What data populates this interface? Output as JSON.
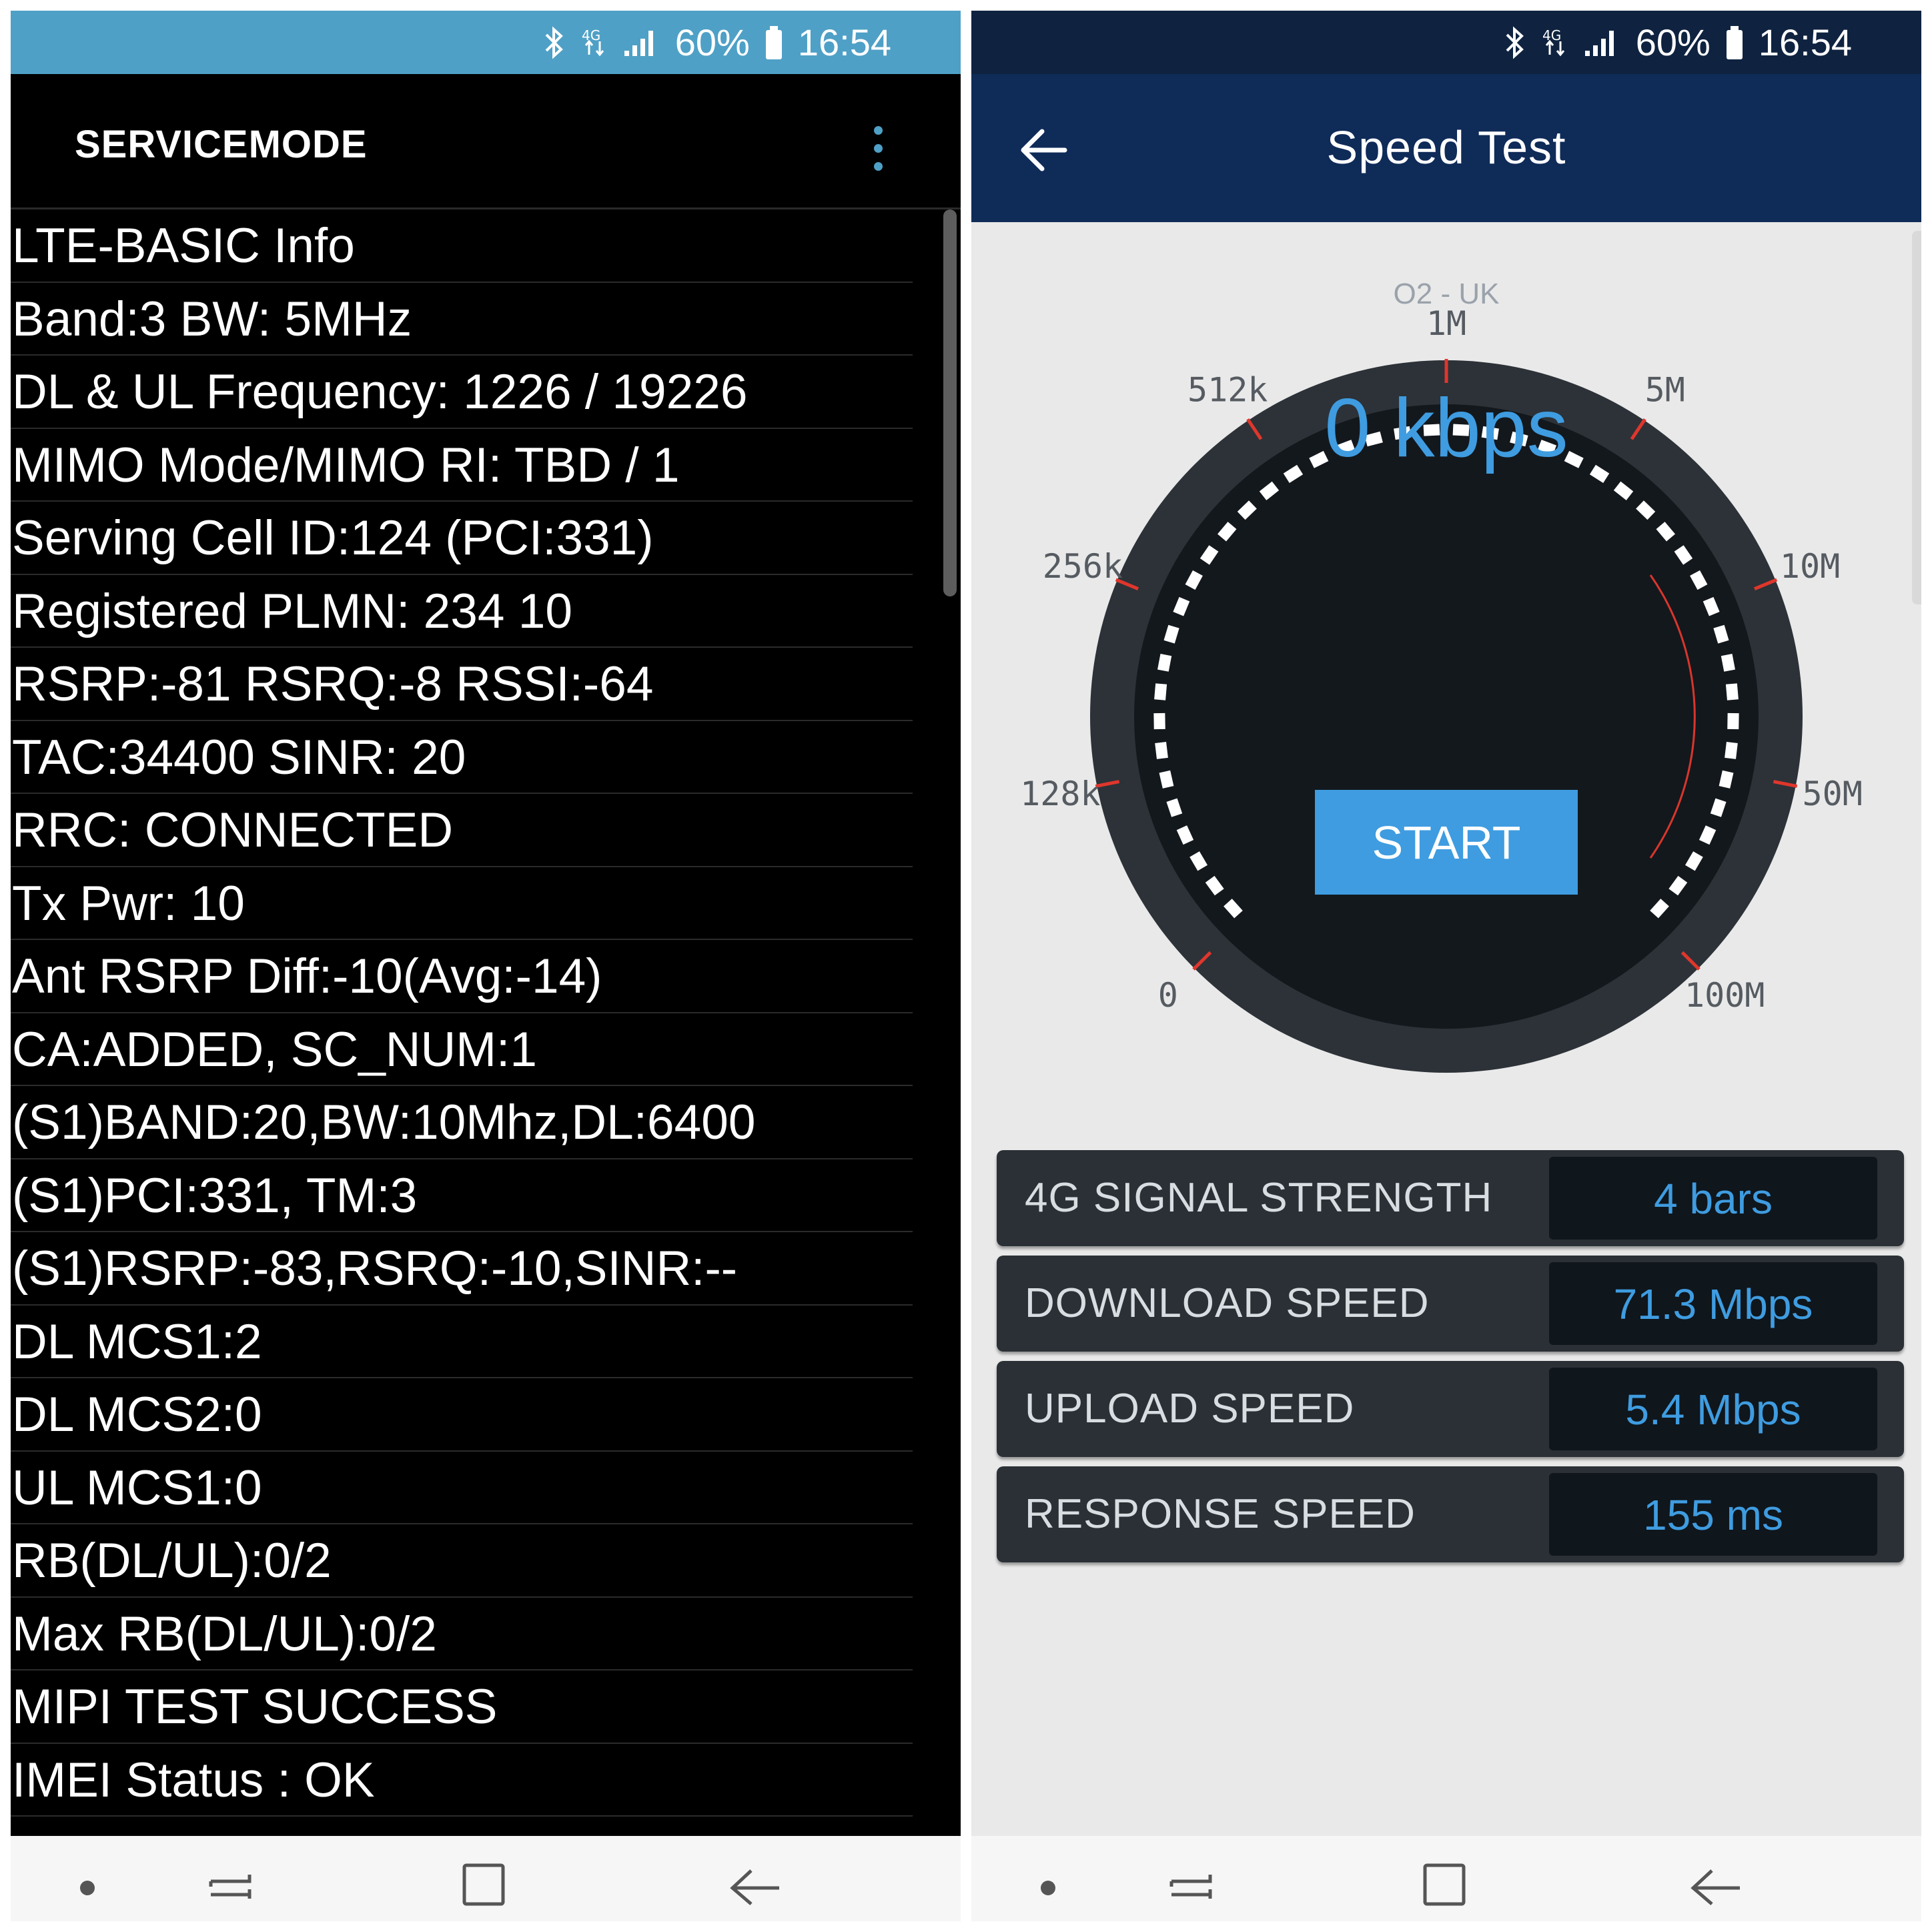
{
  "status": {
    "battery": "60%",
    "time": "16:54",
    "network": "4G"
  },
  "left": {
    "title": "SERVICEMODE",
    "lines": [
      "LTE-BASIC Info",
      "Band:3 BW: 5MHz",
      "DL & UL Frequency: 1226 / 19226",
      "MIMO Mode/MIMO RI: TBD / 1",
      "Serving Cell ID:124 (PCI:331)",
      "Registered PLMN: 234 10",
      "RSRP:-81 RSRQ:-8 RSSI:-64",
      "TAC:34400 SINR: 20",
      "RRC: CONNECTED",
      "Tx Pwr: 10",
      "Ant RSRP Diff:-10(Avg:-14)",
      "CA:ADDED, SC_NUM:1",
      "(S1)BAND:20,BW:10Mhz,DL:6400",
      "(S1)PCI:331, TM:3",
      "(S1)RSRP:-83,RSRQ:-10,SINR:--",
      "DL MCS1:2",
      "DL MCS2:0",
      "UL MCS1:0",
      "RB(DL/UL):0/2",
      "Max RB(DL/UL):0/2",
      "MIPI TEST SUCCESS",
      "IMEI Status : OK"
    ]
  },
  "right": {
    "title": "Speed Test",
    "gauge": {
      "operator": "O2 - UK",
      "speed": "0 kbps",
      "start_label": "START",
      "scale_labels": [
        "0",
        "128k",
        "256k",
        "512k",
        "1M",
        "5M",
        "10M",
        "50M",
        "100M"
      ]
    },
    "stats": [
      {
        "label": "4G SIGNAL STRENGTH",
        "value": "4 bars"
      },
      {
        "label": "DOWNLOAD SPEED",
        "value": "71.3 Mbps"
      },
      {
        "label": "UPLOAD SPEED",
        "value": "5.4 Mbps"
      },
      {
        "label": "RESPONSE SPEED",
        "value": "155 ms"
      }
    ]
  },
  "colors": {
    "left_status": "#4fa0c6",
    "right_status": "#0f2340",
    "right_header": "#0f2b58",
    "accent_blue": "#3f9ce0",
    "tick_red": "#e0362c"
  }
}
